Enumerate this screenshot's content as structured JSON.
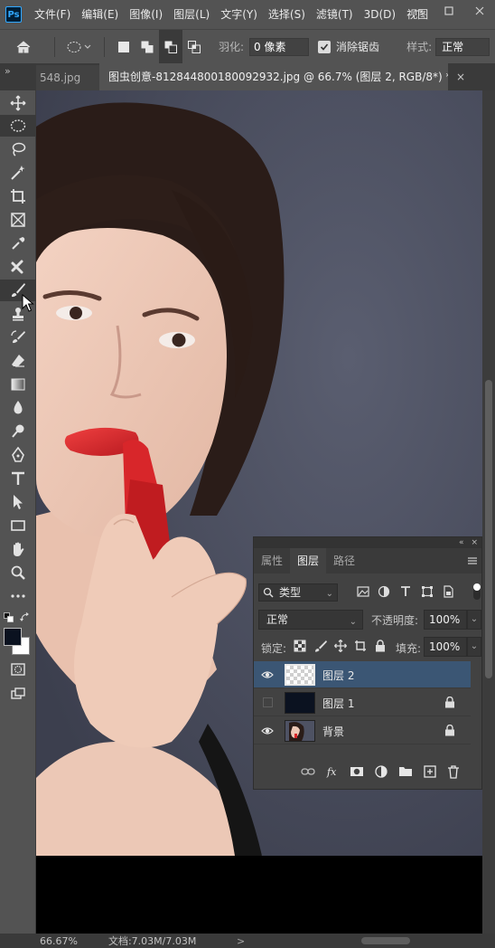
{
  "app": {
    "logo": "Ps"
  },
  "menu": [
    "文件(F)",
    "编辑(E)",
    "图像(I)",
    "图层(L)",
    "文字(Y)",
    "选择(S)",
    "滤镜(T)",
    "3D(D)",
    "视图"
  ],
  "options": {
    "feather_label": "羽化:",
    "feather_value": "0 像素",
    "anti_alias_label": "消除锯齿",
    "anti_alias_checked": true,
    "style_label": "样式:",
    "style_value": "正常"
  },
  "tabs": {
    "previous": "548.jpg",
    "active": "图虫创意-812844800180092932.jpg @ 66.7% (图层 2, RGB/8*) *",
    "close": "×"
  },
  "toolbar": {
    "tools": [
      "move-icon",
      "elliptical-marquee-icon",
      "lasso-icon",
      "magic-wand-icon",
      "crop-icon",
      "frame-icon",
      "eyedropper-icon",
      "healing-brush-icon",
      "brush-icon",
      "clone-stamp-icon",
      "history-brush-icon",
      "eraser-icon",
      "gradient-icon",
      "blur-icon",
      "dodge-icon",
      "pen-icon",
      "type-icon",
      "path-selection-icon",
      "rectangle-icon",
      "hand-icon",
      "zoom-icon",
      "more-tools-icon"
    ],
    "active_tool": "brush-icon",
    "foreground_color": "#0b1220",
    "background_color": "#ffffff"
  },
  "status": {
    "zoom": "66.67%",
    "doc_size": "文档:7.03M/7.03M",
    "arrow": ">"
  },
  "layers_panel": {
    "tabs": [
      "属性",
      "图层",
      "路径"
    ],
    "active_tab": "图层",
    "filter_type": "类型",
    "blend_mode": "正常",
    "opacity_label": "不透明度:",
    "opacity_value": "100%",
    "lock_label": "锁定:",
    "fill_label": "填充:",
    "fill_value": "100%",
    "layers": [
      {
        "name": "图层 2",
        "visible": true,
        "selected": true,
        "locked": false
      },
      {
        "name": "图层 1",
        "visible": false,
        "selected": false,
        "locked": true
      },
      {
        "name": "背景",
        "visible": true,
        "selected": false,
        "locked": true
      }
    ]
  },
  "colors": {
    "accent_selected": "#3b5674",
    "lipstick": "#d8262a",
    "backdrop": "#4c5062"
  }
}
